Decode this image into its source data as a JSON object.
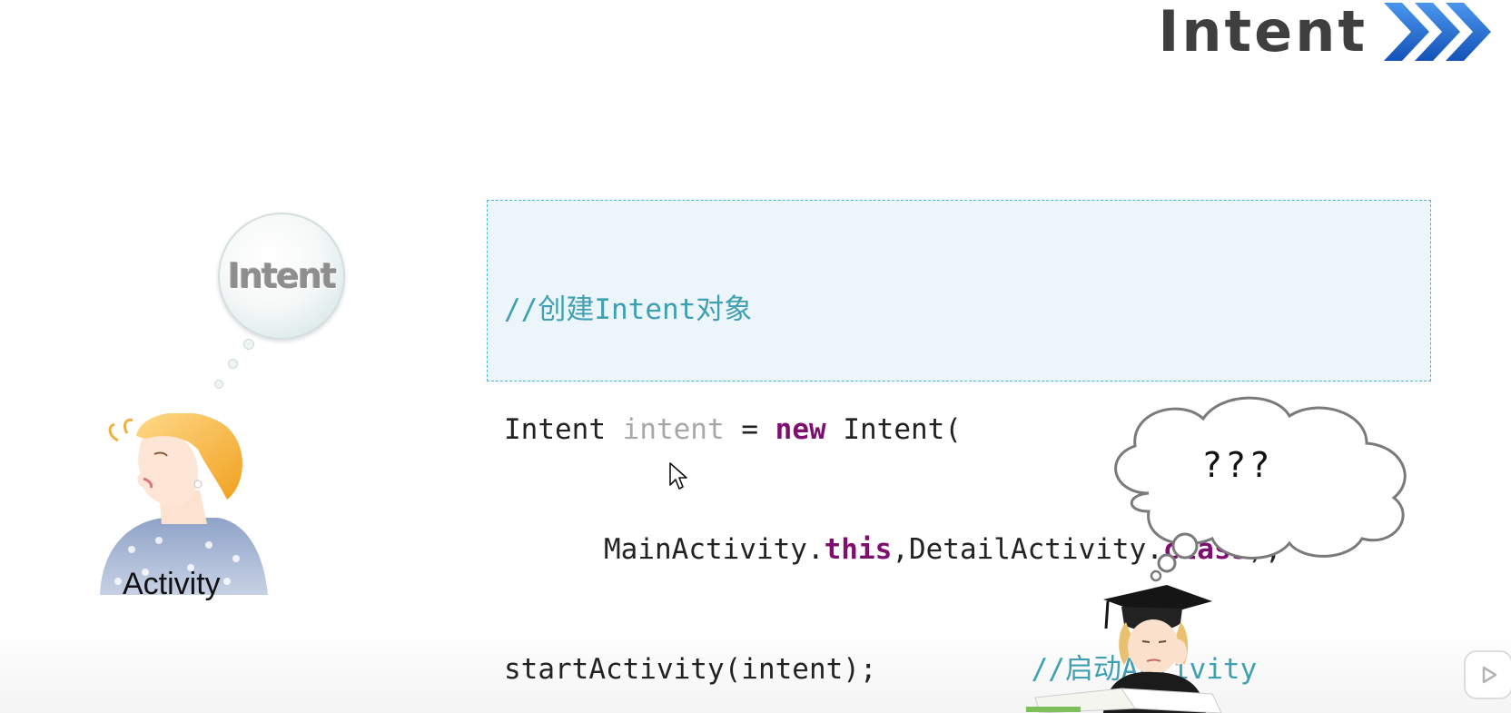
{
  "slide": {
    "title": "Intent"
  },
  "code": {
    "line1_comment": "//创建Intent对象",
    "line2_type": "Intent",
    "line2_var": "intent",
    "line2_eq": "=",
    "line2_new": "new",
    "line2_ctor": "Intent(",
    "line3_arg1": "MainActivity.",
    "line3_this": "this",
    "line3_arg2": ",DetailActivity.",
    "line3_class": "class",
    "line3_end": ");",
    "line4_call": "startActivity(intent);",
    "line4_comment": "//启动Activity"
  },
  "illustration": {
    "intent_bubble_label": "Intent",
    "activity_label": "Activity",
    "question_marks": "???"
  },
  "icons": {
    "title_chevrons": "triple-chevron-right-icon",
    "cursor": "mouse-pointer-icon",
    "play": "play-icon"
  },
  "colors": {
    "chevron_blue": "#1f6fd1",
    "code_border": "#4db6d2",
    "code_bg": "#ecf5fa",
    "comment": "#3f9fb3",
    "keyword": "#7f0f6e"
  }
}
